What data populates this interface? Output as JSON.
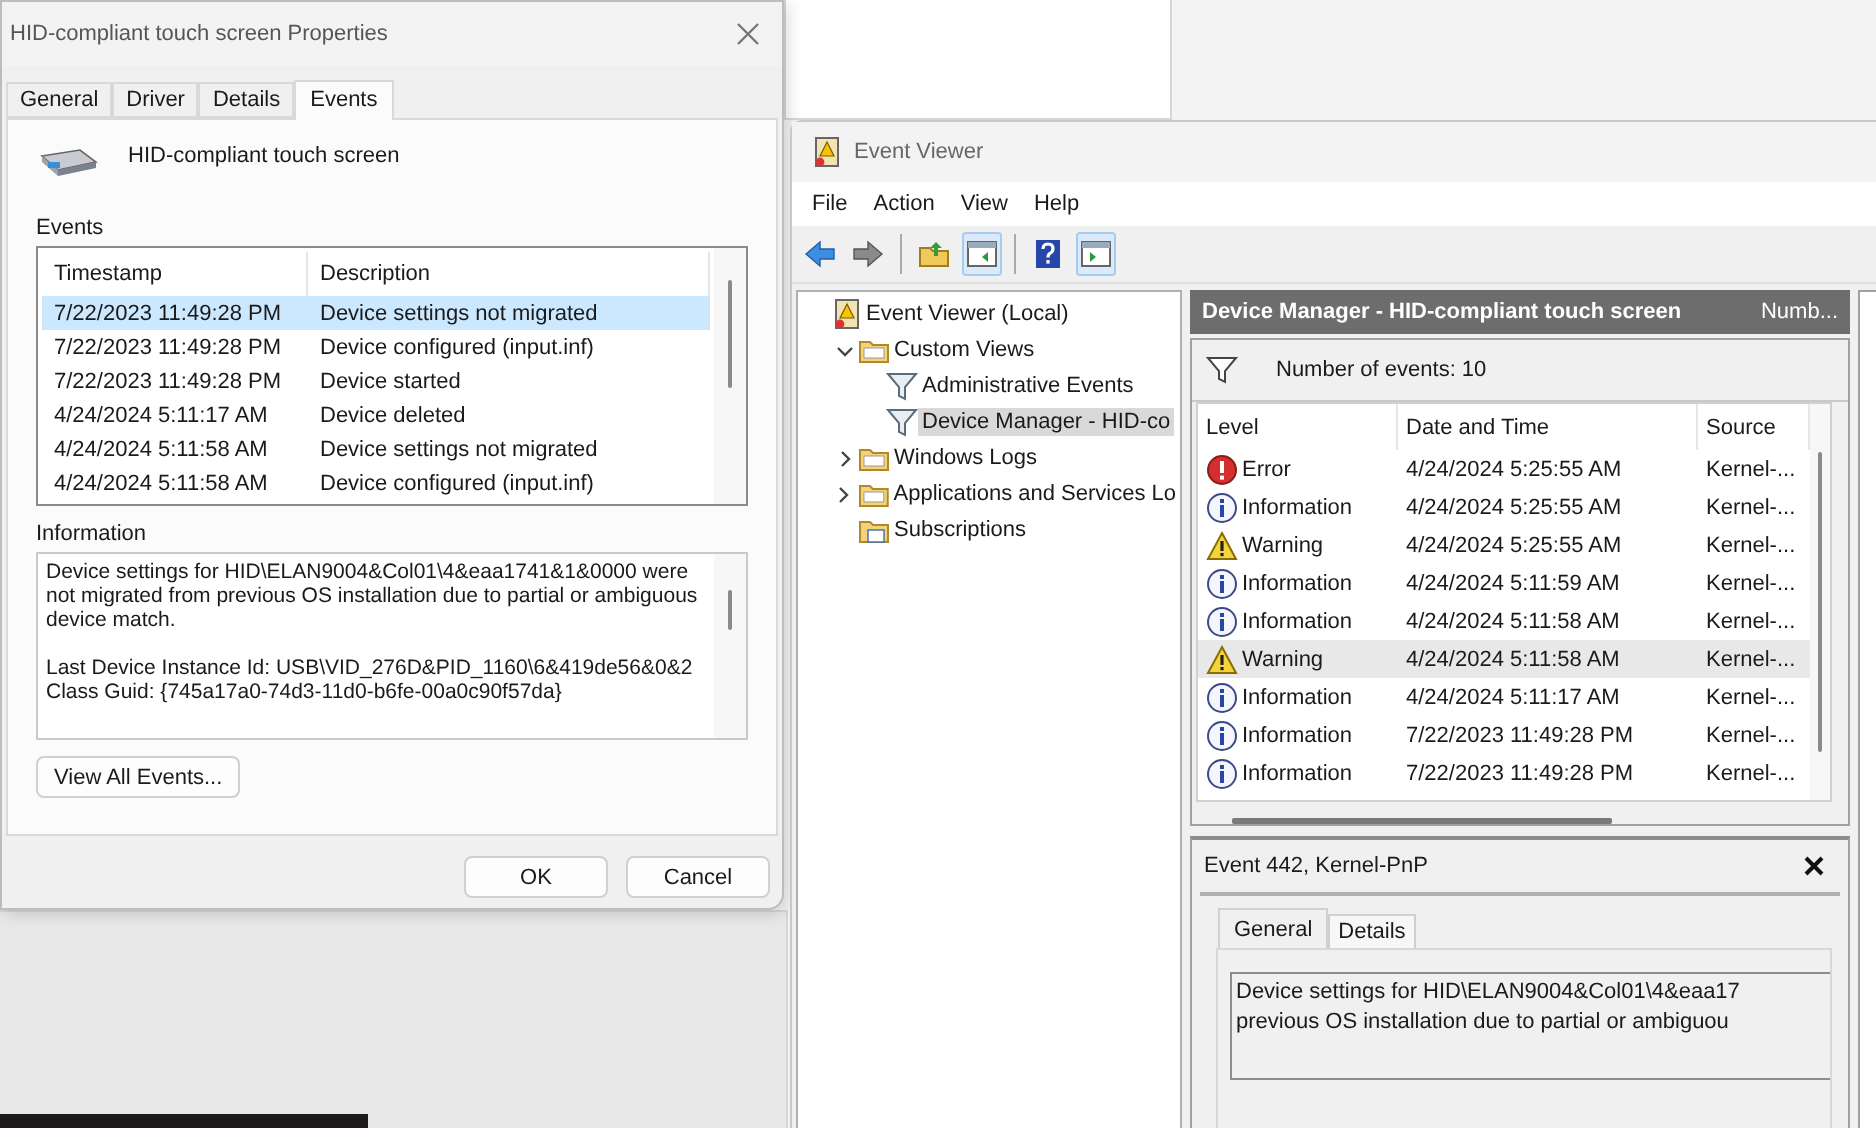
{
  "properties_dialog": {
    "title": "HID-compliant touch screen Properties",
    "tabs": [
      {
        "label": "General",
        "selected": false
      },
      {
        "label": "Driver",
        "selected": false
      },
      {
        "label": "Details",
        "selected": false
      },
      {
        "label": "Events",
        "selected": true
      }
    ],
    "device_name": "HID-compliant touch screen",
    "events_label": "Events",
    "events_table": {
      "columns": [
        "Timestamp",
        "Description"
      ],
      "rows": [
        {
          "timestamp": "7/22/2023 11:49:28 PM",
          "description": "Device settings not migrated",
          "selected": true
        },
        {
          "timestamp": "7/22/2023 11:49:28 PM",
          "description": "Device configured (input.inf)",
          "selected": false
        },
        {
          "timestamp": "7/22/2023 11:49:28 PM",
          "description": "Device started",
          "selected": false
        },
        {
          "timestamp": "4/24/2024 5:11:17 AM",
          "description": "Device deleted",
          "selected": false
        },
        {
          "timestamp": "4/24/2024 5:11:58 AM",
          "description": "Device settings not migrated",
          "selected": false
        },
        {
          "timestamp": "4/24/2024 5:11:58 AM",
          "description": "Device configured (input.inf)",
          "selected": false
        }
      ]
    },
    "information_label": "Information",
    "information_text": [
      "Device settings for HID\\ELAN9004&Col01\\4&eaa1741&1&0000 were not migrated from previous OS installation due to partial or ambiguous device match.",
      "Last Device Instance Id: USB\\VID_276D&PID_1160\\6&419de56&0&2",
      "Class Guid: {745a17a0-74d3-11d0-b6fe-00a0c90f57da}"
    ],
    "view_all_button": "View All Events...",
    "ok_button": "OK",
    "cancel_button": "Cancel"
  },
  "event_viewer": {
    "title": "Event Viewer",
    "menu": [
      "File",
      "Action",
      "View",
      "Help"
    ],
    "tree": [
      {
        "label": "Event Viewer (Local)",
        "kind": "root",
        "selected": false,
        "children": [
          {
            "label": "Custom Views",
            "kind": "folder",
            "expanded": true,
            "selected": false,
            "children": [
              {
                "label": "Administrative Events",
                "kind": "view",
                "selected": false
              },
              {
                "label": "Device Manager - HID-co",
                "kind": "view",
                "selected": true
              }
            ]
          },
          {
            "label": "Windows Logs",
            "kind": "folder",
            "expanded": false,
            "selected": false
          },
          {
            "label": "Applications and Services Lo",
            "kind": "folder",
            "expanded": false,
            "selected": false
          },
          {
            "label": "Subscriptions",
            "kind": "subscriptions",
            "selected": false
          }
        ]
      }
    ],
    "pane_title": "Device Manager - HID-compliant touch screen",
    "pane_subtitle": "Numb...",
    "event_count": "Number of events: 10",
    "columns": [
      "Level",
      "Date and Time",
      "Source"
    ],
    "rows": [
      {
        "kind": "error",
        "level_label": "Error",
        "date": "4/24/2024 5:25:55 AM",
        "source": "Kernel-...",
        "selected": false
      },
      {
        "kind": "information",
        "level_label": "Information",
        "date": "4/24/2024 5:25:55 AM",
        "source": "Kernel-...",
        "selected": false
      },
      {
        "kind": "warning",
        "level_label": "Warning",
        "date": "4/24/2024 5:25:55 AM",
        "source": "Kernel-...",
        "selected": false
      },
      {
        "kind": "information",
        "level_label": "Information",
        "date": "4/24/2024 5:11:59 AM",
        "source": "Kernel-...",
        "selected": false
      },
      {
        "kind": "information",
        "level_label": "Information",
        "date": "4/24/2024 5:11:58 AM",
        "source": "Kernel-...",
        "selected": false
      },
      {
        "kind": "warning",
        "level_label": "Warning",
        "date": "4/24/2024 5:11:58 AM",
        "source": "Kernel-...",
        "selected": true
      },
      {
        "kind": "information",
        "level_label": "Information",
        "date": "4/24/2024 5:11:17 AM",
        "source": "Kernel-...",
        "selected": false
      },
      {
        "kind": "information",
        "level_label": "Information",
        "date": "7/22/2023 11:49:28 PM",
        "source": "Kernel-...",
        "selected": false
      },
      {
        "kind": "information",
        "level_label": "Information",
        "date": "7/22/2023 11:49:28 PM",
        "source": "Kernel-...",
        "selected": false
      }
    ],
    "detail_title": "Event 442, Kernel-PnP",
    "detail_tabs": [
      {
        "label": "General",
        "selected": true
      },
      {
        "label": "Details",
        "selected": false
      }
    ],
    "detail_text_lines": [
      "Device settings for HID\\ELAN9004&Col01\\4&eaa17",
      "previous OS installation due to partial or ambiguou"
    ]
  }
}
